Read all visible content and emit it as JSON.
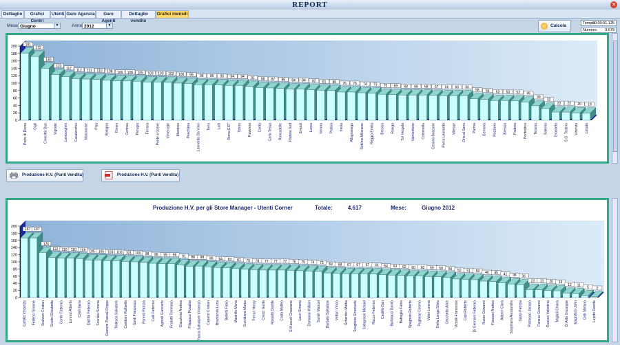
{
  "window": {
    "title": "REPORT",
    "close_icon": "close-icon"
  },
  "tabs": [
    {
      "label": "Dettaglio",
      "active": false
    },
    {
      "label": "Grafici Centri",
      "active": false
    },
    {
      "label": "Utenti",
      "active": false
    },
    {
      "label": "Gare Agenzia",
      "active": false
    },
    {
      "label": "Gare Agenti",
      "active": false
    },
    {
      "label": "Dettaglio vendite",
      "active": false
    },
    {
      "label": "Grafici mensili",
      "active": true
    }
  ],
  "filters": {
    "month_label": "Mese",
    "month_value": "Giugno",
    "year_label": "Anno",
    "year_value": "2012"
  },
  "toolbar": {
    "calcola_label": "Calcola"
  },
  "info": {
    "time_label": "Tempo:",
    "time_value": "00:00:01.125",
    "count_label": "Numero:",
    "count_value": "9.679"
  },
  "export": {
    "print_label": "Produzione H.V. (Punti Vendita)",
    "pdf_label": "Produzione H.V. (Punti Vendita)"
  },
  "colors": {
    "bar_front": "#ccffff",
    "bar_top": "#8fd6d0",
    "bar_side": "#3f8f89",
    "wall": "#1c2a9c",
    "panel_border": "#2fa886"
  },
  "chart_data": [
    {
      "type": "bar",
      "title": "",
      "ylim": [
        0,
        200
      ],
      "yticks": [
        0,
        20,
        40,
        60,
        80,
        100,
        120,
        140,
        160,
        180,
        200
      ],
      "categories": [
        "Porto di Roma",
        "Gigli",
        "Cinecittà Due",
        "Vignate",
        "Lamborghini",
        "Casalecchio",
        "Marcianise",
        "Pisa",
        "Bologna",
        "Rimini",
        "Certosa",
        "Perugia",
        "Ferrara",
        "Ponte a Greve",
        "Vimercate",
        "Mantova",
        "Peschiera",
        "Leonardo Da Vinci",
        "Terni",
        "Lodi",
        "Roma EST",
        "Torino",
        "Ravenna",
        "Cantù",
        "Carlo Tessa",
        "Roncadelle",
        "Padova Sud",
        "Empoli",
        "Lucca",
        "Verona",
        "Pistoia",
        "Imola",
        "Albignasego",
        "Settimo Milanese",
        "Reggio Emilia",
        "Brescia",
        "Rovigo",
        "Tor Vergata",
        "Valmontone",
        "Colonnella",
        "Cesano Boscone",
        "Parco Leonardo",
        "Villesse",
        "Orio al Serio",
        "Parma",
        "Gemona",
        "Rozzano",
        "Brescia",
        "Padova",
        "Pontedera",
        "Teramo",
        "Salerno",
        "Grosseto",
        "S.G. Teatino",
        "Vicenza",
        "Lonato"
      ],
      "values": [
        181,
        172,
        140,
        123,
        117,
        112,
        111,
        110,
        108,
        106,
        106,
        105,
        103,
        103,
        102,
        100,
        99,
        96,
        96,
        95,
        94,
        94,
        91,
        88,
        87,
        86,
        84,
        84,
        82,
        81,
        80,
        76,
        76,
        74,
        73,
        70,
        69,
        68,
        68,
        68,
        67,
        66,
        66,
        66,
        58,
        56,
        53,
        53,
        52,
        49,
        39,
        32,
        22,
        22,
        20,
        19
      ]
    },
    {
      "type": "bar",
      "title": "Produzione H.V. per gli Store Manager - Utenti Corner",
      "total_label": "Totale:",
      "total_value": "4.617",
      "month_label": "Mese:",
      "month_value": "Giugno  2012",
      "ylim": [
        0,
        200
      ],
      "yticks": [
        0,
        20,
        40,
        60,
        80,
        100,
        120,
        140,
        160,
        180,
        200
      ],
      "categories": [
        "Camillo Vincenzo",
        "Federici Simone",
        "Scalvoni Cristian",
        "Giudici Elisabetta",
        "Conte Federico",
        "Lorenzi Alberto",
        "Cirelli Ilaria",
        "Dall'Ali Federico",
        "Scarlato Simona",
        "Giacomi Pascali Filippo",
        "Tedesco Salvatore",
        "Candiani Raffaello",
        "Santi Francesco",
        "Parenti Patrizia",
        "Calli Federico",
        "Agresti Giancarlo",
        "Frabotti Tommaso",
        "Giacchino Andrea",
        "Filippucci Rosalba",
        "Ranca Salvatore Vincenzo",
        "Capano Cristian",
        "Brazzarola Luca",
        "Belletti Fabio",
        "Mastrillo Maria",
        "Guerdiana Marco",
        "Ferrari Henry",
        "Cresci Guido",
        "Rossetti Davide",
        "Costa Matteo",
        "El Kaoudi Ghassane",
        "Lauri Simona",
        "Damiano William",
        "Sandri Manuel",
        "Barbato Salvatore",
        "Vettori Vincio",
        "Schembri Mattia",
        "Scaglione Emanuele",
        "Colagrossi Michael",
        "Rocco Federico",
        "Castillo Dan",
        "Bartolacci Danilo",
        "Battaglia Fabio",
        "Spagnolo Roberto",
        "Pugliese Cosimo",
        "Valeri Lorena",
        "Della Longa Silvio",
        "Cecchetto Alice",
        "Uccelli Francesco",
        "Capi Roberto",
        "Di Gennaro Federico",
        "Russo Giovanni",
        "Fasciani Andrea",
        "Aldeeri Clara",
        "Scopinaro Alessandro",
        "Savio Patrizia",
        "Patronaci Jacopo",
        "Fanese Giovanni",
        "Ruocco Valentina",
        "Miglioli Chiara",
        "Di Aldo Giuseppe",
        "Magnifichi John",
        "Celli Stefano",
        "Lepido Davide"
      ],
      "values": [
        167,
        167,
        126,
        112,
        110,
        110,
        109,
        105,
        105,
        103,
        103,
        101,
        100,
        98,
        96,
        95,
        95,
        91,
        88,
        88,
        86,
        84,
        83,
        81,
        79,
        78,
        77,
        77,
        77,
        76,
        75,
        74,
        73,
        69,
        68,
        67,
        67,
        67,
        66,
        64,
        63,
        62,
        60,
        60,
        59,
        58,
        56,
        52,
        51,
        50,
        46,
        45,
        41,
        38,
        36,
        22,
        22,
        20,
        19,
        12,
        11,
        5,
        2
      ]
    }
  ]
}
